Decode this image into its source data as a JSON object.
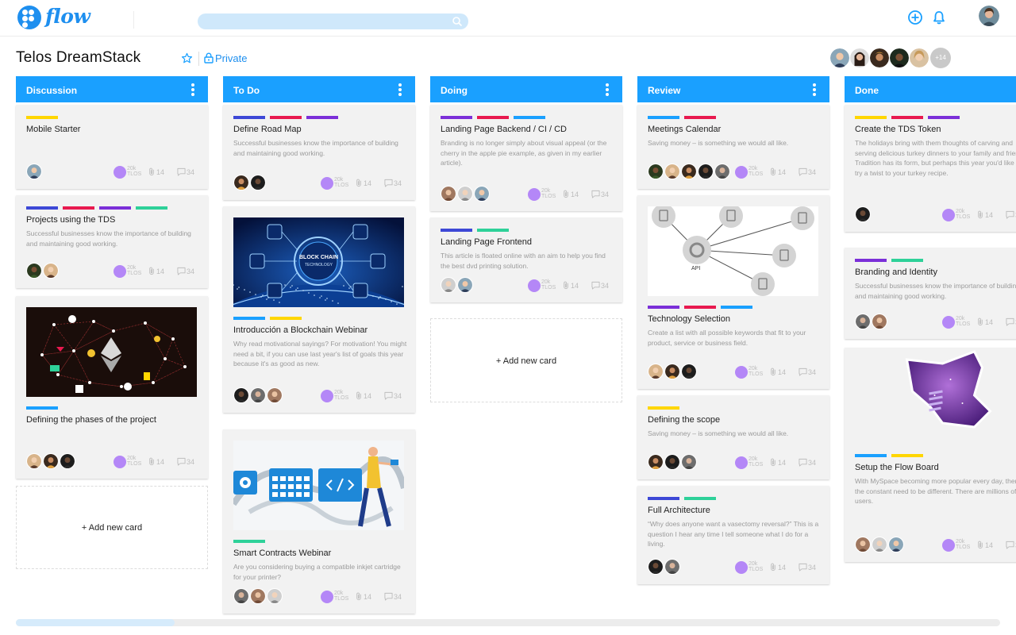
{
  "app": {
    "name": "flow"
  },
  "search": {
    "placeholder": ""
  },
  "board": {
    "title": "Telos DreamStack",
    "privacy": "Private",
    "members_more": "+14"
  },
  "colors": {
    "accent": "#1aa0ff",
    "purple": "#7b2fd8",
    "red": "#e8194f",
    "blue": "#1aa0ff",
    "yellow": "#ffd600",
    "green": "#2ed199",
    "indigo": "#3d48d6",
    "coin": "#b487f7"
  },
  "stats_defaults": {
    "coin": "20k TLOS",
    "attachments": "14",
    "comments": "34"
  },
  "add_card_label": "+ Add new card",
  "columns": [
    {
      "title": "Discussion",
      "cards": [
        {
          "tags": [
            "yellow"
          ],
          "title": "Mobile Starter",
          "desc": ""
        },
        {
          "tags": [
            "indigo",
            "red",
            "purple",
            "green"
          ],
          "title": "Projects using the TDS",
          "desc": "Successful businesses know the importance of building and maintaining good working."
        },
        {
          "tags": [
            "blue"
          ],
          "title": "Defining the phases of the project",
          "desc": "",
          "image": "ethereum-network-illustration"
        }
      ]
    },
    {
      "title": "To Do",
      "cards": [
        {
          "tags": [
            "indigo",
            "red",
            "purple"
          ],
          "title": "Define Road Map",
          "desc": "Successful businesses know the importance of building and maintaining good working."
        },
        {
          "tags": [
            "blue",
            "yellow"
          ],
          "title": "Introducción a Blockchain Webinar",
          "desc": "Why read motivational sayings? For motivation! You might need a bit, if you can use last year's list of goals this year because it's as good as new.",
          "image": "blockchain-technology-globe",
          "image_text": "BLOCK CHAIN",
          "image_subtext": "TECHNOLOGY"
        },
        {
          "tags": [
            "green"
          ],
          "title": "Smart Contracts Webinar",
          "desc": "Are you considering buying a compatible inkjet cartridge for your printer?",
          "image": "developer-workflow-illustration"
        }
      ]
    },
    {
      "title": "Doing",
      "cards": [
        {
          "tags": [
            "purple",
            "red",
            "blue"
          ],
          "title": "Landing Page Backend / CI / CD",
          "desc": "Branding is no longer simply about visual appeal (or the cherry in the apple pie example, as given in my earlier article)."
        },
        {
          "tags": [
            "indigo",
            "green"
          ],
          "title": "Landing Page Frontend",
          "desc": "This article is floated online with an aim to help you find the best dvd printing solution."
        }
      ]
    },
    {
      "title": "Review",
      "cards": [
        {
          "tags": [
            "blue",
            "red"
          ],
          "title": "Meetings Calendar",
          "desc": "Saving money – is something we would all like."
        },
        {
          "tags": [
            "purple",
            "red",
            "blue"
          ],
          "title": "Technology Selection",
          "desc": "Create a list with all possible keywords that fit to your product, service or business field.",
          "image": "api-network-diagram",
          "image_text": "API"
        },
        {
          "tags": [
            "yellow"
          ],
          "title": "Defining the scope",
          "desc": "Saving money – is something we would all like."
        },
        {
          "tags": [
            "indigo",
            "green"
          ],
          "title": "Full Architecture",
          "desc": "“Why does anyone want a vasectomy reversal?” This is a question I hear any time I tell someone what I do for a living."
        }
      ]
    },
    {
      "title": "Done",
      "cards": [
        {
          "tags": [
            "yellow",
            "red",
            "purple"
          ],
          "title": "Create the TDS Token",
          "desc": "The holidays bring with them thoughts of carving and serving delicious turkey dinners to your family and friends. Tradition has its form, but perhaps this year you'd like to try a twist to your turkey recipe."
        },
        {
          "tags": [
            "purple",
            "green"
          ],
          "title": "Branding and Identity",
          "desc": "Successful businesses know the importance of building and maintaining good working."
        },
        {
          "tags": [
            "blue",
            "yellow"
          ],
          "title": "Setup the Flow Board",
          "desc": "With MySpace becoming more popular every day, there is the constant need to be different. There are millions of users.",
          "image": "purple-galaxy-shape"
        }
      ]
    }
  ]
}
